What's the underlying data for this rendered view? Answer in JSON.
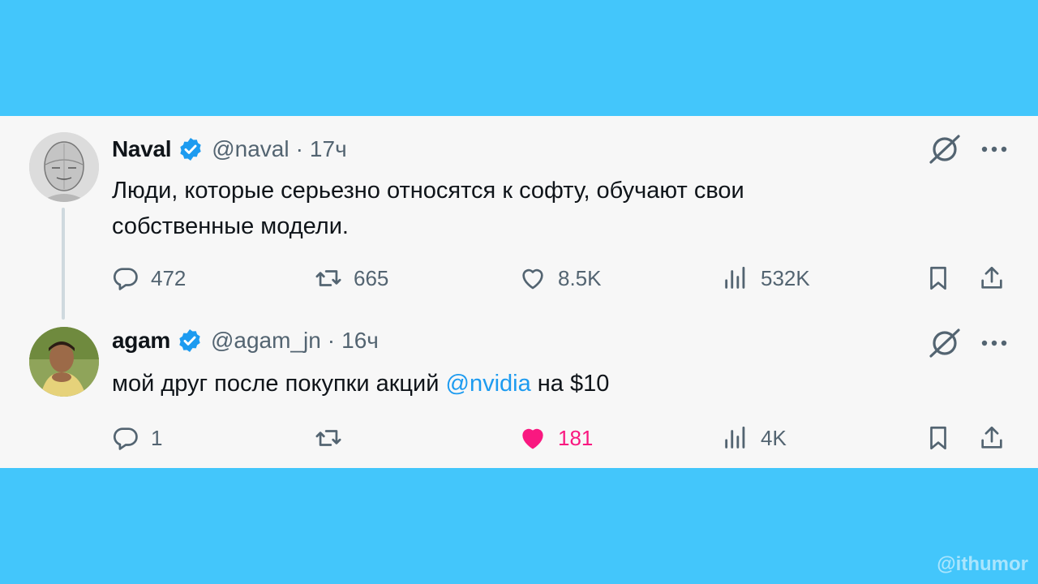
{
  "tweets": [
    {
      "name": "Naval",
      "handle": "@naval",
      "separator": "·",
      "time": "17ч",
      "text": "Люди, которые серьезно относятся к софту, обучают свои собственные модели.",
      "actions": {
        "replies": "472",
        "retweets": "665",
        "likes": "8.5K",
        "views": "532K"
      }
    },
    {
      "name": "agam",
      "handle": "@agam_jn",
      "separator": "·",
      "time": "16ч",
      "text_before": "мой друг после покупки акций ",
      "mention": "@nvidia",
      "text_after": " на $10",
      "actions": {
        "replies": "1",
        "retweets": "",
        "likes": "181",
        "views": "4K"
      }
    }
  ],
  "watermark": "@ithumor",
  "colors": {
    "background": "#43c6fb",
    "card": "#f7f7f7",
    "text": "#0f1419",
    "secondary": "#536471",
    "verified": "#1d9bf0",
    "mention": "#1d9bf0",
    "like": "#f91880"
  },
  "icons": [
    "verified-badge-icon",
    "grok-icon",
    "more-icon",
    "reply-icon",
    "retweet-icon",
    "like-icon",
    "views-icon",
    "bookmark-icon",
    "share-icon"
  ]
}
